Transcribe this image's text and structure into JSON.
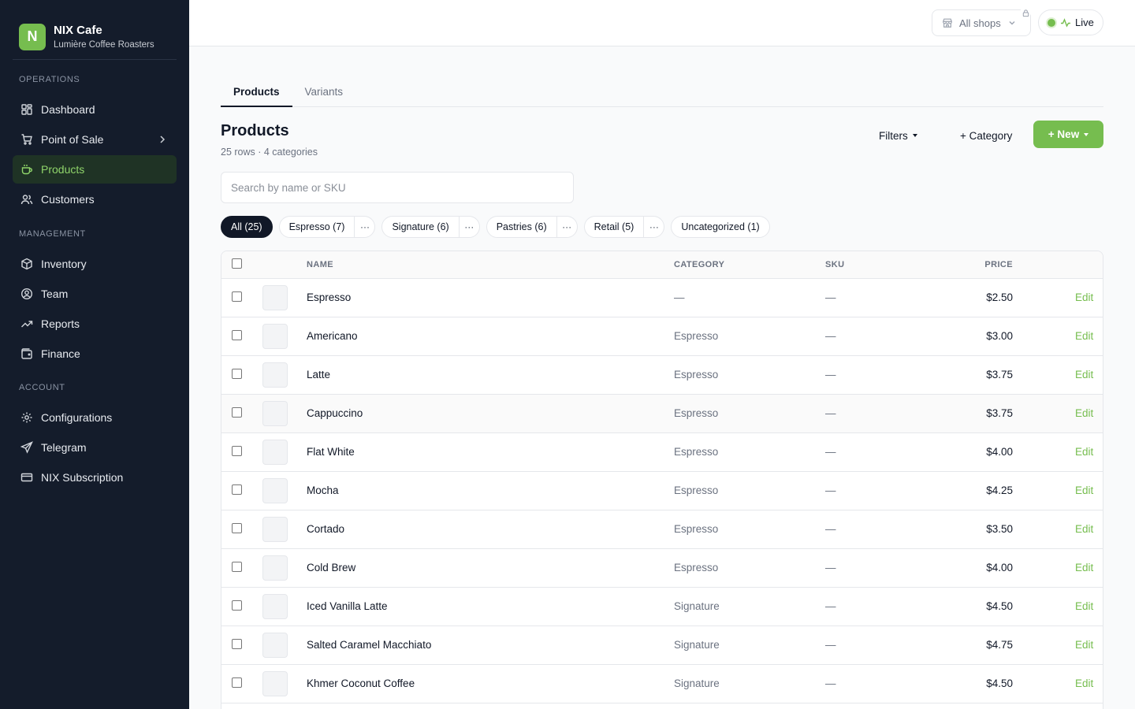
{
  "app": {
    "logo_letter": "N",
    "name": "NIX Cafe",
    "subtitle": "Lumière Coffee Roasters"
  },
  "sidebar": {
    "sections": [
      {
        "heading": "OPERATIONS",
        "items": [
          {
            "label": "Dashboard",
            "icon": "dashboard-icon"
          },
          {
            "label": "Point of Sale",
            "icon": "cart-icon",
            "has_submenu": true
          },
          {
            "label": "Products",
            "icon": "coffee-cup-icon",
            "active": true
          },
          {
            "label": "Customers",
            "icon": "users-icon"
          }
        ]
      },
      {
        "heading": "MANAGEMENT",
        "items": [
          {
            "label": "Inventory",
            "icon": "box-icon"
          },
          {
            "label": "Team",
            "icon": "user-circle-icon"
          },
          {
            "label": "Reports",
            "icon": "trend-up-icon"
          },
          {
            "label": "Finance",
            "icon": "wallet-icon"
          }
        ]
      },
      {
        "heading": "ACCOUNT",
        "items": [
          {
            "label": "Configurations",
            "icon": "gear-icon"
          },
          {
            "label": "Telegram",
            "icon": "send-icon"
          },
          {
            "label": "NIX Subscription",
            "icon": "credit-card-icon"
          }
        ]
      }
    ]
  },
  "topbar": {
    "shop_select": "All shops",
    "live_label": "Live"
  },
  "tabs": [
    {
      "label": "Products",
      "active": true
    },
    {
      "label": "Variants",
      "active": false
    }
  ],
  "page": {
    "title": "Products",
    "subtitle": "25 rows · 4 categories",
    "filters_label": "Filters",
    "category_label": "+ Category",
    "new_label": "+ New"
  },
  "search": {
    "placeholder": "Search by name or SKU",
    "value": ""
  },
  "chips": [
    {
      "label": "All (25)",
      "active": true,
      "more": false
    },
    {
      "label": "Espresso (7)",
      "active": false,
      "more": true
    },
    {
      "label": "Signature (6)",
      "active": false,
      "more": true
    },
    {
      "label": "Pastries (6)",
      "active": false,
      "more": true
    },
    {
      "label": "Retail (5)",
      "active": false,
      "more": true
    },
    {
      "label": "Uncategorized (1)",
      "active": false,
      "more": false
    }
  ],
  "chip_more_glyph": "···",
  "table": {
    "headers": {
      "name": "NAME",
      "category": "CATEGORY",
      "sku": "SKU",
      "price": "PRICE"
    },
    "edit_label": "Edit",
    "rows": [
      {
        "name": "Espresso",
        "category": "—",
        "sku": "—",
        "price": "$2.50"
      },
      {
        "name": "Americano",
        "category": "Espresso",
        "sku": "—",
        "price": "$3.00"
      },
      {
        "name": "Latte",
        "category": "Espresso",
        "sku": "—",
        "price": "$3.75"
      },
      {
        "name": "Cappuccino",
        "category": "Espresso",
        "sku": "—",
        "price": "$3.75"
      },
      {
        "name": "Flat White",
        "category": "Espresso",
        "sku": "—",
        "price": "$4.00"
      },
      {
        "name": "Mocha",
        "category": "Espresso",
        "sku": "—",
        "price": "$4.25"
      },
      {
        "name": "Cortado",
        "category": "Espresso",
        "sku": "—",
        "price": "$3.50"
      },
      {
        "name": "Cold Brew",
        "category": "Espresso",
        "sku": "—",
        "price": "$4.00"
      },
      {
        "name": "Iced Vanilla Latte",
        "category": "Signature",
        "sku": "—",
        "price": "$4.50"
      },
      {
        "name": "Salted Caramel Macchiato",
        "category": "Signature",
        "sku": "—",
        "price": "$4.75"
      },
      {
        "name": "Khmer Coconut Coffee",
        "category": "Signature",
        "sku": "—",
        "price": "$4.50"
      }
    ]
  },
  "colors": {
    "sidebar_bg": "#141c2b",
    "accent": "#76bd4f",
    "active_nav_bg": "#1f3325",
    "active_nav_text": "#8fd46a"
  }
}
